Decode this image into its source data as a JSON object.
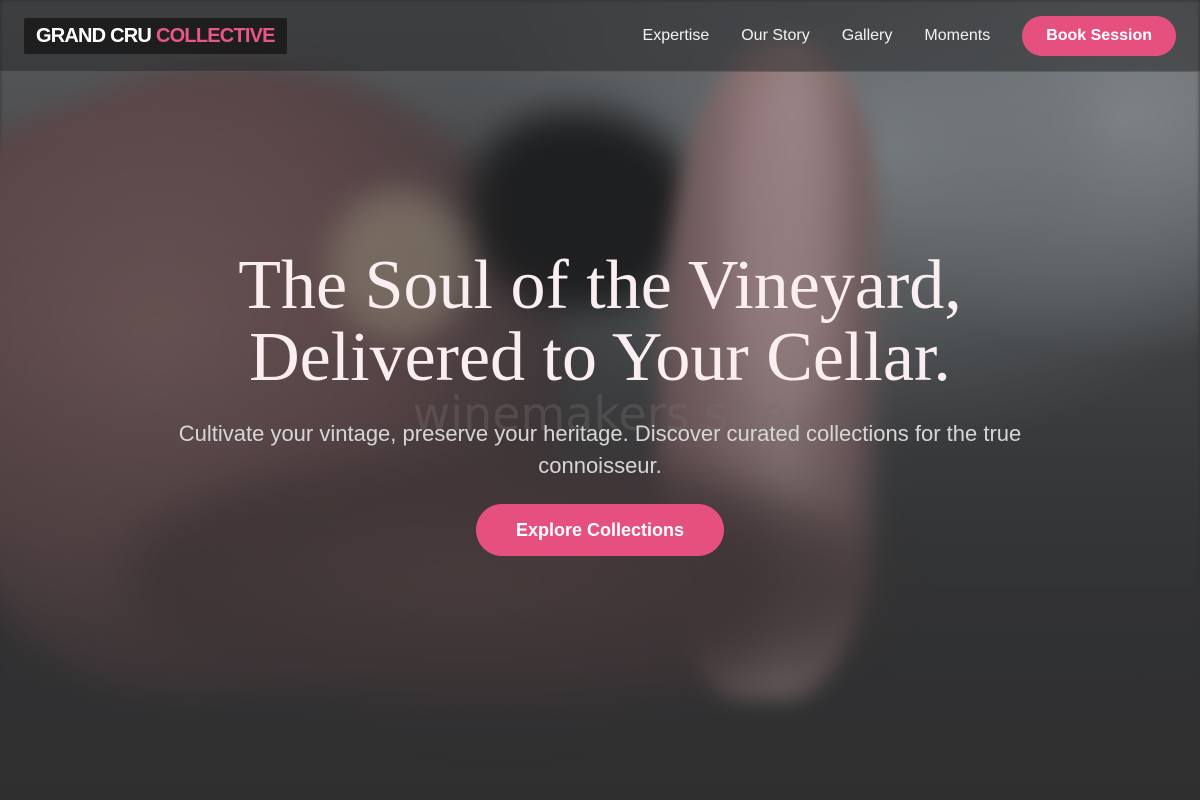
{
  "brand": {
    "name_part1": "GRAND CRU",
    "name_part2": "COLLECTIVE",
    "accent_color": "#e5507f"
  },
  "nav": {
    "items": [
      {
        "label": "Expertise"
      },
      {
        "label": "Our Story"
      },
      {
        "label": "Gallery"
      },
      {
        "label": "Moments"
      }
    ],
    "cta_label": "Book Session"
  },
  "hero": {
    "title_line1": "The Soul of the Vineyard,",
    "title_line2": "Delivered to Your Cellar.",
    "watermark": "winemakers site",
    "subtitle": "Cultivate your vintage, preserve your heritage. Discover curated collections for the true connoisseur.",
    "cta_label": "Explore Collections"
  }
}
